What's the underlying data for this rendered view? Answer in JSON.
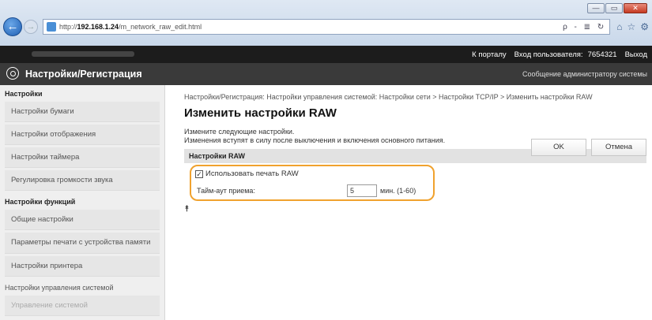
{
  "browser": {
    "url_prefix": "http://",
    "url_host": "192.168.1.24",
    "url_path": "/m_network_raw_edit.html",
    "addr_tools": "ρ - ≣ ↻",
    "icons": [
      "⌂",
      "☆",
      "⚙"
    ],
    "win_buttons": [
      "—",
      "▭",
      "✕"
    ]
  },
  "topbar": {
    "portal_link": "К порталу",
    "login_label": "Вход пользователя:",
    "login_value": "7654321",
    "logout": "Выход"
  },
  "header": {
    "title": "Настройки/Регистрация",
    "admin_message": "Сообщение администратору системы"
  },
  "sidebar": {
    "cat1": "Настройки",
    "items1": [
      "Настройки бумаги",
      "Настройки отображения",
      "Настройки таймера",
      "Регулировка громкости звука"
    ],
    "cat2": "Настройки функций",
    "items2": [
      "Общие настройки",
      "Параметры печати с устройства памяти",
      "Настройки принтера"
    ],
    "cat3": "Настройки управления системой",
    "faded_item": "Управление системой"
  },
  "main": {
    "breadcrumb": "Настройки/Регистрация: Настройки управления системой: Настройки сети > Настройки TCP/IP > Изменить настройки RAW",
    "title": "Изменить настройки RAW",
    "info_line1": "Измените следующие настройки.",
    "info_line2": "Изменения вступят в силу после выключения и включения основного питания.",
    "ok_label": "OK",
    "cancel_label": "Отмена",
    "section_header": "Настройки RAW",
    "use_raw_label": "Использовать печать RAW",
    "use_raw_checked": true,
    "timeout_label": "Тайм-аут приема:",
    "timeout_value": "5",
    "timeout_units": "мин. (1-60)",
    "top_arrow": "⯭"
  },
  "colors": {
    "highlight": "#f0a22e",
    "header_bg": "#3a3a3a",
    "topbar_bg": "#1c1c1c"
  }
}
